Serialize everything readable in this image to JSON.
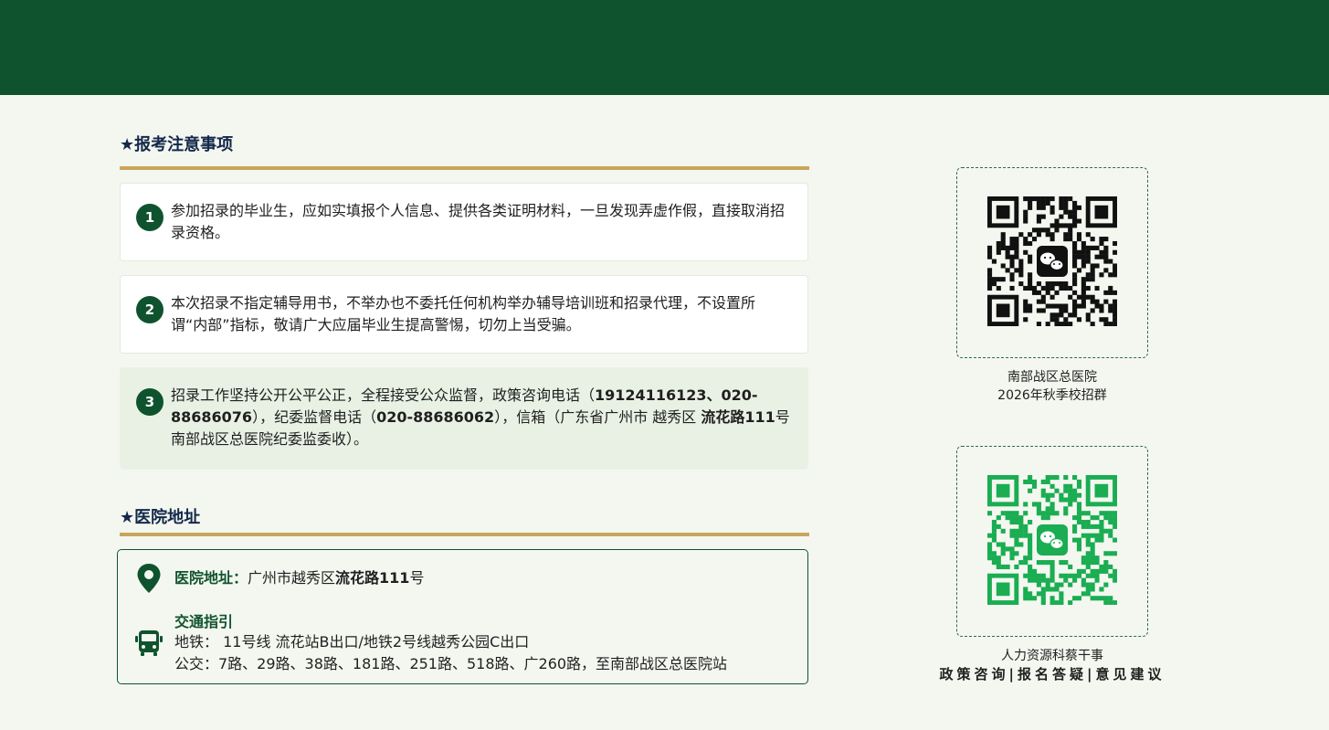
{
  "notice": {
    "title": "★报考注意事项",
    "items": [
      {
        "num": "1",
        "text": "参加招录的毕业生，应如实填报个人信息、提供各类证明材料，一旦发现弄虚作假，直接取消招录资格。"
      },
      {
        "num": "2",
        "text": "本次招录不指定辅导用书，不举办也不委托任何机构举办辅导培训班和招录代理，不设置所谓“内部”指标，敬请广大应届毕业生提高警惕，切勿上当受骗。"
      },
      {
        "num": "3",
        "text_a": "招录工作坚持公开公平公正，全程接受公众监督，政策咨询电话（",
        "phone1": "19124116123、020-88686076",
        "text_b": "），纪委监督电话（",
        "phone2": "020-88686062",
        "text_c": "），信箱（广东省广州市 越秀区 ",
        "road": "流花路111",
        "text_d": "号南部战区总医院纪委监委收）。"
      }
    ]
  },
  "address": {
    "title": "★医院地址",
    "label": "医院地址：",
    "value_a": "广州市越秀区",
    "value_b": "流花路111",
    "value_c": "号",
    "traffic_title": "交通指引",
    "metro": "地铁： 11号线 流花站B出口/地铁2号线越秀公园C出口",
    "bus": "公交：7路、29路、38路、181路、251路、518路、广260路，至南部战区总医院站"
  },
  "qr1": {
    "icon": "wechat-icon",
    "caption_line1": "南部战区总医院",
    "caption_line2": "2026年秋季校招群",
    "color": "#111111"
  },
  "qr2": {
    "icon": "wechat-icon",
    "caption_line1": "人力资源科蔡干事",
    "caption_line2": "政策咨询|报名答疑|意见建议",
    "color": "#1aad52"
  },
  "colors": {
    "brand_green": "#0f532e",
    "gold": "#c9a55c",
    "background": "#f4f7f0"
  }
}
